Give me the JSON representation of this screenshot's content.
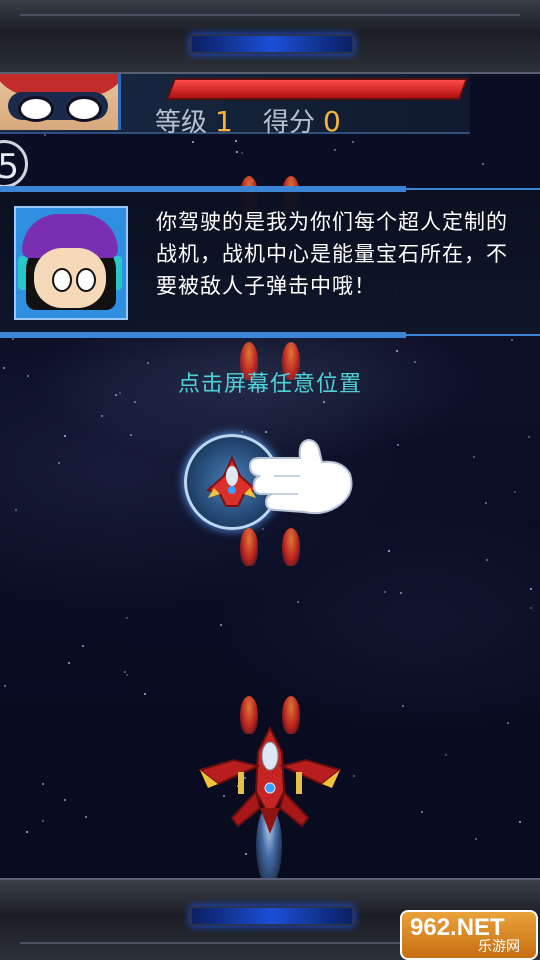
{
  "hud": {
    "level_label": "等级",
    "level_value": "1",
    "score_label": "得分",
    "score_value": "0",
    "hp_fraction": 1.0
  },
  "countdown": "5",
  "dialog": {
    "text": "你驾驶的是我为你们每个超人定制的战机，战机中心是能量宝石所在，不要被敌人子弹击中哦！"
  },
  "hint": "点击屏幕任意位置",
  "watermark": {
    "brand": "962.NET",
    "sub": "乐游网"
  },
  "colors": {
    "accent_blue": "#3b84d6",
    "hint_cyan": "#4ed2d8",
    "score_orange": "#f4b43a",
    "hp_red": "#e02424"
  }
}
